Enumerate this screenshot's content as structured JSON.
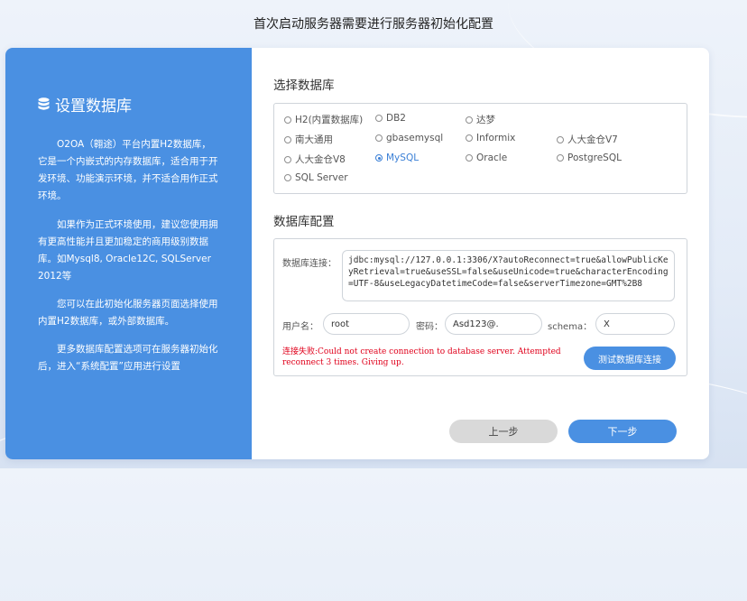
{
  "page": {
    "title": "首次启动服务器需要进行服务器初始化配置"
  },
  "sidebar": {
    "title": "设置数据库",
    "icon": "database-icon",
    "paragraphs": [
      "O2OA（翱途）平台内置H2数据库，它是一个内嵌式的内存数据库，适合用于开发环境、功能演示环境，并不适合用作正式环境。",
      "如果作为正式环境使用，建议您使用拥有更高性能并且更加稳定的商用级别数据库。如Mysql8, Oracle12C, SQLServer 2012等",
      "您可以在此初始化服务器页面选择使用内置H2数据库，或外部数据库。",
      "更多数据库配置选项可在服务器初始化后，进入“系统配置”应用进行设置"
    ]
  },
  "select_db": {
    "title": "选择数据库",
    "options": [
      "H2(内置数据库)",
      "DB2",
      "达梦",
      "南大通用",
      "gbasemysql",
      "Informix",
      "人大金仓V7",
      "人大金仓V8",
      "MySQL",
      "Oracle",
      "PostgreSQL",
      "SQL Server"
    ],
    "selected": "MySQL"
  },
  "db_config": {
    "title": "数据库配置",
    "url_label": "数据库连接：",
    "url_value": "jdbc:mysql://127.0.0.1:3306/X?autoReconnect=true&allowPublicKeyRetrieval=true&useSSL=false&useUnicode=true&characterEncoding=UTF-8&useLegacyDatetimeCode=false&serverTimezone=GMT%2B8",
    "user_label": "用户名：",
    "user_value": "root",
    "password_label": "密码：",
    "password_value": "Asd123@.",
    "schema_label": "schema：",
    "schema_value": "X",
    "error_text": "连接失败:Could not create connection to database server. Attempted reconnect 3 times. Giving up.",
    "test_button": "测试数据库连接"
  },
  "footer": {
    "prev_label": "上一步",
    "next_label": "下一步"
  },
  "colors": {
    "accent": "#4a90e2",
    "error": "#e0001b"
  }
}
